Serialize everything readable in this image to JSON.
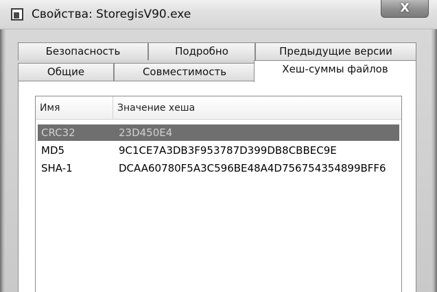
{
  "window": {
    "title": "Свойства: StoregisV90.exe",
    "close_glyph": "X"
  },
  "tabs": {
    "back_row": [
      "Безопасность",
      "Подробно",
      "Предыдущие версии"
    ],
    "front_row": [
      "Общие",
      "Совместимость",
      "Хеш-суммы файлов"
    ],
    "active": "Хеш-суммы файлов"
  },
  "hash_list": {
    "columns": [
      "Имя",
      "Значение хеша"
    ],
    "rows": [
      {
        "name": "CRC32",
        "value": "23D450E4",
        "selected": true
      },
      {
        "name": "MD5",
        "value": "9C1CE7A3DB3F953787D399DB8CBBEC9E",
        "selected": false
      },
      {
        "name": "SHA-1",
        "value": "DCAA60780F5A3C596BE48A4D756754354899BFF6",
        "selected": false
      }
    ]
  },
  "icons": {
    "app": "app-window-icon",
    "close": "close-icon"
  },
  "colors": {
    "selection": "#6f6f6f",
    "selection_text": "#d0d0d0"
  }
}
